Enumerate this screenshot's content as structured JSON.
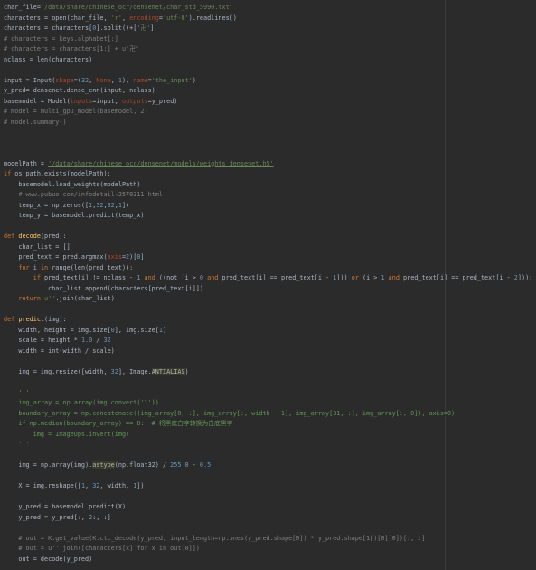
{
  "editor": {
    "lines": [
      [
        [
          "char_file=",
          "p"
        ],
        [
          "'/data/share/chinese_ocr/densenet/char_std_5990.txt'",
          "s"
        ]
      ],
      [
        [
          "characters = ",
          "p"
        ],
        [
          "open",
          "p"
        ],
        [
          "(char_file, ",
          "p"
        ],
        [
          "'r'",
          "s"
        ],
        [
          ", ",
          "p"
        ],
        [
          "encoding",
          "k"
        ],
        [
          "=",
          "p"
        ],
        [
          "'utf-8'",
          "s"
        ],
        [
          ").readlines()",
          "p"
        ]
      ],
      [
        [
          "characters = characters[",
          "p"
        ],
        [
          "0",
          "n"
        ],
        [
          "].split()+[",
          "p"
        ],
        [
          "'卍'",
          "s"
        ],
        [
          "]",
          "p"
        ]
      ],
      [
        [
          "# characters = keys.alphabet[:]",
          "c"
        ]
      ],
      [
        [
          "# characters = characters[1:] + u'卍'",
          "c"
        ]
      ],
      [
        [
          "nclass = ",
          "p"
        ],
        [
          "len",
          "p"
        ],
        [
          "(characters)",
          "p"
        ]
      ],
      [
        [
          "",
          "p"
        ]
      ],
      [
        [
          "input = Input(",
          "p"
        ],
        [
          "shape",
          "k"
        ],
        [
          "=(",
          "p"
        ],
        [
          "32",
          "n"
        ],
        [
          ", ",
          "p"
        ],
        [
          "None",
          "k"
        ],
        [
          ", ",
          "p"
        ],
        [
          "1",
          "n"
        ],
        [
          "), ",
          "p"
        ],
        [
          "name",
          "k"
        ],
        [
          "=",
          "p"
        ],
        [
          "'the_input'",
          "s"
        ],
        [
          ")",
          "p"
        ]
      ],
      [
        [
          "y_pred= densenet.dense_cnn(input, nclass)",
          "p"
        ]
      ],
      [
        [
          "basemodel = Model(",
          "p"
        ],
        [
          "inputs",
          "k"
        ],
        [
          "=input, ",
          "p"
        ],
        [
          "outputs",
          "k"
        ],
        [
          "=y_pred)",
          "p"
        ]
      ],
      [
        [
          "# model = multi_gpu_model(basemodel, 2)",
          "c"
        ]
      ],
      [
        [
          "# model.summary()",
          "c"
        ]
      ],
      [
        [
          "",
          "p"
        ]
      ],
      [
        [
          "",
          "p"
        ]
      ],
      [
        [
          "",
          "p"
        ]
      ],
      [
        [
          "modelPath = ",
          "p"
        ],
        [
          "'/data/share/chinese_ocr/densenet/models/weights_densenet.h5'",
          "su"
        ]
      ],
      [
        [
          "if ",
          "kw"
        ],
        [
          "os.path.exists(modelPath):",
          "p"
        ]
      ],
      [
        [
          "    basemodel.load_weights(modelPath)",
          "p"
        ]
      ],
      [
        [
          "    # www.pubuo.com/infodetail-2570311.html",
          "c"
        ]
      ],
      [
        [
          "    temp_x = np.zeros([",
          "p"
        ],
        [
          "1",
          "n"
        ],
        [
          ",",
          "p"
        ],
        [
          "32",
          "n"
        ],
        [
          ",",
          "p"
        ],
        [
          "32",
          "n"
        ],
        [
          ",",
          "p"
        ],
        [
          "1",
          "n"
        ],
        [
          "])",
          "p"
        ]
      ],
      [
        [
          "    temp_y = basemodel.predict(temp_x)",
          "p"
        ]
      ],
      [
        [
          "",
          "p"
        ]
      ],
      [
        [
          "def ",
          "kw"
        ],
        [
          "decode",
          "f"
        ],
        [
          "(pred):",
          "p"
        ]
      ],
      [
        [
          "    char_list = []",
          "p"
        ]
      ],
      [
        [
          "    pred_text = pred.argmax(",
          "p"
        ],
        [
          "axis",
          "k"
        ],
        [
          "=",
          "p"
        ],
        [
          "2",
          "n"
        ],
        [
          ")[",
          "p"
        ],
        [
          "0",
          "n"
        ],
        [
          "]",
          "p"
        ]
      ],
      [
        [
          "    ",
          "p"
        ],
        [
          "for ",
          "kw"
        ],
        [
          "i ",
          "p"
        ],
        [
          "in ",
          "kw"
        ],
        [
          "range",
          "p"
        ],
        [
          "(",
          "p"
        ],
        [
          "len",
          "p"
        ],
        [
          "(pred_text)):",
          "p"
        ]
      ],
      [
        [
          "        ",
          "p"
        ],
        [
          "if ",
          "kw"
        ],
        [
          "pred_text[i] != nclass - ",
          "p"
        ],
        [
          "1 ",
          "n"
        ],
        [
          "and ",
          "kw"
        ],
        [
          "((not (i > ",
          "p"
        ],
        [
          "0 ",
          "n"
        ],
        [
          "and ",
          "kw"
        ],
        [
          "pred_text[i] == pred_text[i - ",
          "p"
        ],
        [
          "1",
          "n"
        ],
        [
          "])) ",
          "p"
        ],
        [
          "or ",
          "kw"
        ],
        [
          "(i > ",
          "p"
        ],
        [
          "1 ",
          "n"
        ],
        [
          "and ",
          "kw"
        ],
        [
          "pred_text[i] == pred_text[i - ",
          "p"
        ],
        [
          "2",
          "n"
        ],
        [
          "])):",
          "p"
        ]
      ],
      [
        [
          "            char_list.append(characters[pred_text[i]])",
          "p"
        ]
      ],
      [
        [
          "    ",
          "p"
        ],
        [
          "return ",
          "kw"
        ],
        [
          "u''",
          "s"
        ],
        [
          ".join(char_list)",
          "p"
        ]
      ],
      [
        [
          "",
          "p"
        ]
      ],
      [
        [
          "def ",
          "kw"
        ],
        [
          "predict",
          "f"
        ],
        [
          "(img):",
          "p"
        ]
      ],
      [
        [
          "    width, height = img.size[",
          "p"
        ],
        [
          "0",
          "n"
        ],
        [
          "], img.size[",
          "p"
        ],
        [
          "1",
          "n"
        ],
        [
          "]",
          "p"
        ]
      ],
      [
        [
          "    scale = height * ",
          "p"
        ],
        [
          "1.0 ",
          "n"
        ],
        [
          "/ ",
          "p"
        ],
        [
          "32",
          "n"
        ]
      ],
      [
        [
          "    width = ",
          "p"
        ],
        [
          "int",
          "p"
        ],
        [
          "(width / scale)",
          "p"
        ]
      ],
      [
        [
          "",
          "p"
        ]
      ],
      [
        [
          "    img = img.resize([width, ",
          "p"
        ],
        [
          "32",
          "n"
        ],
        [
          "], Image.",
          "p"
        ],
        [
          "ANTIALIAS",
          "h"
        ],
        [
          ")",
          "p"
        ]
      ],
      [
        [
          "",
          "p"
        ]
      ],
      [
        [
          "    '''",
          "d"
        ]
      ],
      [
        [
          "    img_array = np.array(img.convert('1'))",
          "d"
        ]
      ],
      [
        [
          "    boundary_array = np.concatenate((img_array[0, :], img_array[:, width - 1], img_array[31, :], img_array[:, 0]), axis=0)",
          "d"
        ]
      ],
      [
        [
          "    if np.median(boundary_array) == 0:  # 将黑底白字转换为白底黑字",
          "d"
        ]
      ],
      [
        [
          "        img = ImageOps.invert(img)",
          "d"
        ]
      ],
      [
        [
          "    '''",
          "d"
        ]
      ],
      [
        [
          "",
          "p"
        ]
      ],
      [
        [
          "    img = np.array(img).",
          "p"
        ],
        [
          "astype",
          "h"
        ],
        [
          "(np.float32) / ",
          "p"
        ],
        [
          "255.0 ",
          "n"
        ],
        [
          "- ",
          "p"
        ],
        [
          "0.5",
          "n"
        ]
      ],
      [
        [
          "",
          "p"
        ]
      ],
      [
        [
          "    X = img.reshape([",
          "p"
        ],
        [
          "1",
          "n"
        ],
        [
          ", ",
          "p"
        ],
        [
          "32",
          "n"
        ],
        [
          ", width, ",
          "p"
        ],
        [
          "1",
          "n"
        ],
        [
          "])",
          "p"
        ]
      ],
      [
        [
          "",
          "p"
        ]
      ],
      [
        [
          "    y_pred = basemodel.predict(X)",
          "p"
        ]
      ],
      [
        [
          "    y_pred = y_pred[:, ",
          "p"
        ],
        [
          "2",
          "n"
        ],
        [
          ":, :]",
          "p"
        ]
      ],
      [
        [
          "",
          "p"
        ]
      ],
      [
        [
          "    # out = K.get_value(K.ctc_decode(y_pred, input_length=np.ones(y_pred.shape[0]) * y_pred.shape[1])[0][0])[:, :]",
          "c"
        ]
      ],
      [
        [
          "    # out = u''.join([characters[x] for x in out[0]])",
          "c"
        ]
      ],
      [
        [
          "    out = decode(y_pred)",
          "p"
        ]
      ],
      [
        [
          "",
          "p"
        ]
      ],
      [
        [
          "    ",
          "p"
        ],
        [
          "return ",
          "kw"
        ],
        [
          "out",
          "p"
        ]
      ]
    ]
  }
}
